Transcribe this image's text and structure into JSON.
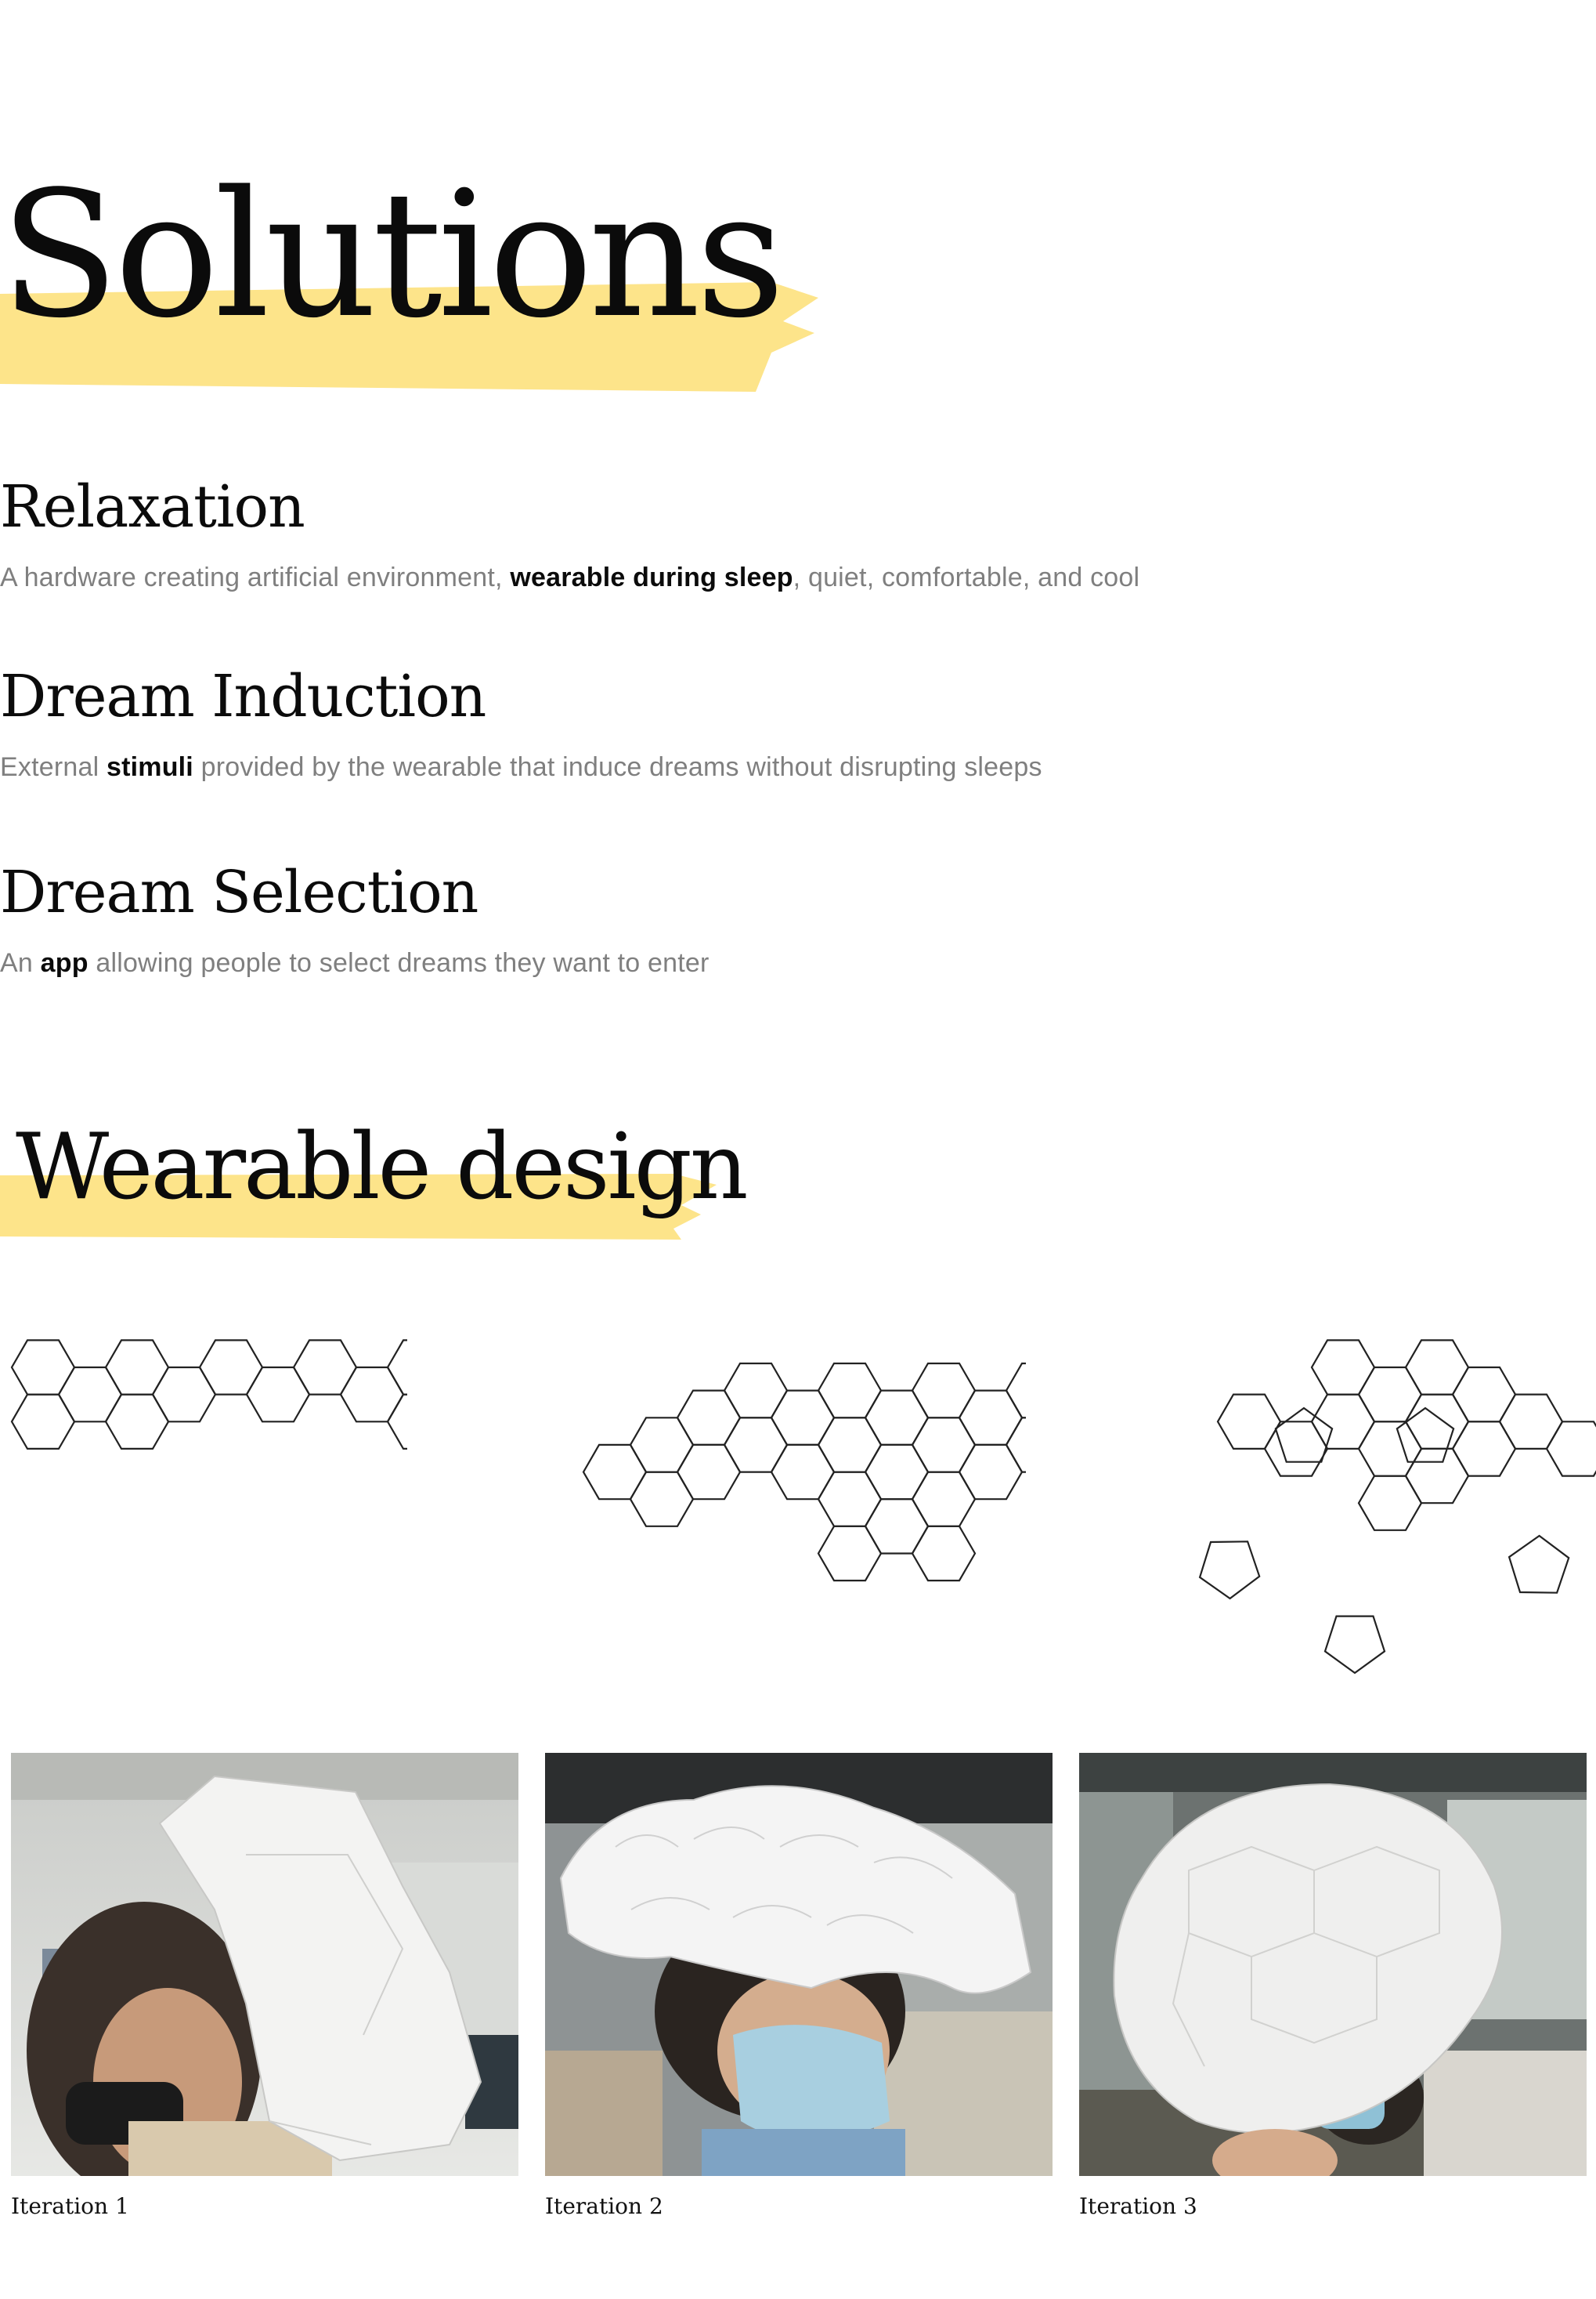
{
  "page": {
    "title": "Solutions",
    "sections": [
      {
        "heading": "Relaxation",
        "desc_before": "A hardware creating artificial environment, ",
        "desc_bold": "wearable during sleep",
        "desc_after": ", quiet, comfortable, and cool"
      },
      {
        "heading": "Dream Induction",
        "desc_before": "External ",
        "desc_bold": "stimuli",
        "desc_after": " provided by the wearable that induce dreams without disrupting sleeps"
      },
      {
        "heading": "Dream Selection",
        "desc_before": "An ",
        "desc_bold": "app",
        "desc_after": " allowing people to select dreams they want to enter"
      }
    ],
    "wearable_title": "Wearable design",
    "iterations": [
      {
        "caption": "Iteration 1"
      },
      {
        "caption": "Iteration 2"
      },
      {
        "caption": "Iteration 3"
      }
    ],
    "colors": {
      "highlight": "#fde48a",
      "body_text": "#7f7f7f",
      "heading_text": "#0b0b0b"
    }
  }
}
